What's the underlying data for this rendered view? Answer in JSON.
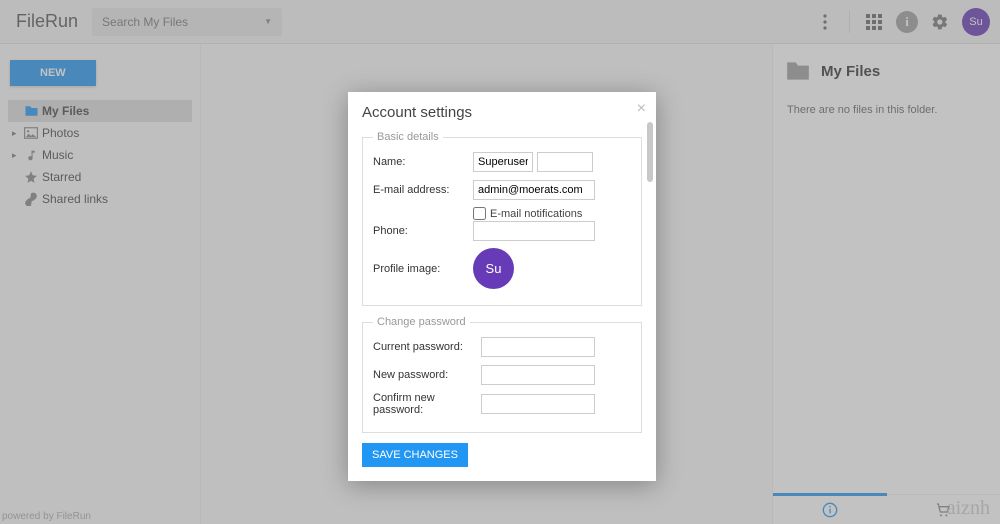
{
  "header": {
    "logo": "FileRun",
    "search_placeholder": "Search My Files",
    "avatar_initials": "Su"
  },
  "sidebar": {
    "new_label": "NEW",
    "items": [
      {
        "label": "My Files",
        "icon": "folder",
        "selected": true,
        "expandable": false
      },
      {
        "label": "Photos",
        "icon": "image",
        "selected": false,
        "expandable": true
      },
      {
        "label": "Music",
        "icon": "music",
        "selected": false,
        "expandable": true
      },
      {
        "label": "Starred",
        "icon": "star",
        "selected": false,
        "expandable": false
      },
      {
        "label": "Shared links",
        "icon": "link",
        "selected": false,
        "expandable": false
      }
    ]
  },
  "right_panel": {
    "title": "My Files",
    "empty_text": "There are no files in this folder."
  },
  "footer": {
    "text": "powered by FileRun"
  },
  "watermark": "aiznh",
  "modal": {
    "title": "Account settings",
    "basic": {
      "legend": "Basic details",
      "name_label": "Name:",
      "name_value": "Superuser",
      "email_label": "E-mail address:",
      "email_value": "admin@moerats.com",
      "notify_label": "E-mail notifications",
      "phone_label": "Phone:",
      "phone_value": "",
      "profile_image_label": "Profile image:",
      "avatar_initials": "Su"
    },
    "password": {
      "legend": "Change password",
      "current_label": "Current password:",
      "new_label": "New password:",
      "confirm_label": "Confirm new password:"
    },
    "save_label": "SAVE CHANGES"
  }
}
